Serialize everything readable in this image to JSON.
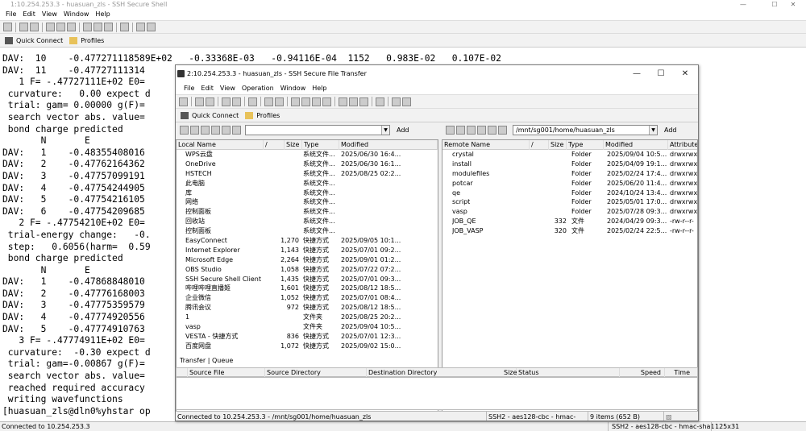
{
  "terminal": {
    "title": "1:10.254.253.3 - huasuan_zls - SSH Secure Shell",
    "menu": [
      "File",
      "Edit",
      "View",
      "Window",
      "Help"
    ],
    "quick_connect": "Quick Connect",
    "profiles": "Profiles",
    "lines": [
      "DAV:  10    -0.477271118589E+02   -0.33368E-03   -0.94116E-04  1152   0.983E-02   0.107E-02",
      "DAV:  11    -0.47727111314",
      "   1 F= -.47727111E+02 E0=",
      " curvature:   0.00 expect d",
      " trial: gam= 0.00000 g(F)=",
      " search vector abs. value=",
      " bond charge predicted",
      "       N       E",
      "DAV:   1    -0.48355408016",
      "DAV:   2    -0.47762164362",
      "DAV:   3    -0.47757099191",
      "DAV:   4    -0.47754244905",
      "DAV:   5    -0.47754216105",
      "DAV:   6    -0.47754209685",
      "   2 F= -.47754210E+02 E0=",
      " trial-energy change:   -0.",
      " step:   0.6056(harm=  0.59",
      " bond charge predicted",
      "       N       E",
      "DAV:   1    -0.47868848010",
      "DAV:   2    -0.47776168003",
      "DAV:   3    -0.47775359579",
      "DAV:   4    -0.47774920556",
      "DAV:   5    -0.47774910763",
      "   3 F= -.47774911E+02 E0=",
      " curvature:  -0.30 expect d",
      " trial: gam=-0.00867 g(F)=",
      " search vector abs. value=",
      " reached required accuracy",
      " writing wavefunctions",
      "[huasuan_zls@dln0%yhstar op"
    ],
    "status_left": "Connected to 10.254.253.3",
    "status_cipher": "SSH2 - aes128-cbc - hmac-sha1",
    "status_size": "125x31"
  },
  "sftp": {
    "title": "2:10.254.253.3 - huasuan_zls - SSH Secure File Transfer",
    "menu": [
      "File",
      "Edit",
      "View",
      "Operation",
      "Window",
      "Help"
    ],
    "quick_connect": "Quick Connect",
    "profiles": "Profiles",
    "add_label": "Add",
    "local_path": "",
    "remote_path": "/mnt/sg001/home/huasuan_zls",
    "local_headers": [
      "Local Name",
      "/",
      "Size",
      "Type",
      "Modified"
    ],
    "remote_headers": [
      "Remote Name",
      "/",
      "Size",
      "Type",
      "Modified",
      "Attribute"
    ],
    "local_files": [
      {
        "name": "WPS云盘",
        "size": "",
        "type": "系统文件...",
        "mod": "2025/06/30 16:4...",
        "ic": "cloud"
      },
      {
        "name": "OneDrive",
        "size": "",
        "type": "系统文件...",
        "mod": "2025/06/30 16:1...",
        "ic": "cloud"
      },
      {
        "name": "HSTECH",
        "size": "",
        "type": "系统文件...",
        "mod": "2025/08/25 02:2...",
        "ic": "user"
      },
      {
        "name": "此电脑",
        "size": "",
        "type": "系统文件...",
        "mod": "",
        "ic": "pc"
      },
      {
        "name": "库",
        "size": "",
        "type": "系统文件...",
        "mod": "",
        "ic": "folder"
      },
      {
        "name": "网络",
        "size": "",
        "type": "系统文件...",
        "mod": "",
        "ic": "pc"
      },
      {
        "name": "控制面板",
        "size": "",
        "type": "系统文件...",
        "mod": "",
        "ic": "pc"
      },
      {
        "name": "回收站",
        "size": "",
        "type": "系统文件...",
        "mod": "",
        "ic": "pc"
      },
      {
        "name": "控制面板",
        "size": "",
        "type": "系统文件...",
        "mod": "",
        "ic": "pc"
      },
      {
        "name": "EasyConnect",
        "size": "1,270",
        "type": "快捷方式",
        "mod": "2025/09/05 10:1...",
        "ic": "app"
      },
      {
        "name": "Internet Explorer",
        "size": "1,143",
        "type": "快捷方式",
        "mod": "2025/07/01 09:2...",
        "ic": "app"
      },
      {
        "name": "Microsoft Edge",
        "size": "2,264",
        "type": "快捷方式",
        "mod": "2025/09/01 01:2...",
        "ic": "app"
      },
      {
        "name": "OBS Studio",
        "size": "1,058",
        "type": "快捷方式",
        "mod": "2025/07/22 07:2...",
        "ic": "app"
      },
      {
        "name": "SSH Secure Shell Client",
        "size": "1,435",
        "type": "快捷方式",
        "mod": "2025/07/01 09:3...",
        "ic": "app"
      },
      {
        "name": "哔哩哔哩直播姬",
        "size": "1,601",
        "type": "快捷方式",
        "mod": "2025/08/12 18:5...",
        "ic": "app"
      },
      {
        "name": "企业微信",
        "size": "1,052",
        "type": "快捷方式",
        "mod": "2025/07/01 08:4...",
        "ic": "app"
      },
      {
        "name": "腾讯会议",
        "size": "972",
        "type": "快捷方式",
        "mod": "2025/08/12 18:5...",
        "ic": "app"
      },
      {
        "name": "1",
        "size": "",
        "type": "文件夹",
        "mod": "2025/08/25 20:2...",
        "ic": "folder"
      },
      {
        "name": "vasp",
        "size": "",
        "type": "文件夹",
        "mod": "2025/09/04 10:5...",
        "ic": "folder"
      },
      {
        "name": "VESTA - 快捷方式",
        "size": "836",
        "type": "快捷方式",
        "mod": "2025/07/01 12:3...",
        "ic": "app"
      },
      {
        "name": "百度网盘",
        "size": "1,072",
        "type": "快捷方式",
        "mod": "2025/09/02 15:0...",
        "ic": "cloud"
      }
    ],
    "remote_files": [
      {
        "name": "crystal",
        "size": "",
        "type": "Folder",
        "mod": "2025/09/04 10:5...",
        "attr": "drwxrwx",
        "ic": "folder"
      },
      {
        "name": "install",
        "size": "",
        "type": "Folder",
        "mod": "2025/04/09 19:1...",
        "attr": "drwxrwx",
        "ic": "folder"
      },
      {
        "name": "modulefiles",
        "size": "",
        "type": "Folder",
        "mod": "2025/02/24 17:4...",
        "attr": "drwxrwx",
        "ic": "folder"
      },
      {
        "name": "potcar",
        "size": "",
        "type": "Folder",
        "mod": "2025/06/20 11:4...",
        "attr": "drwxrwx",
        "ic": "folder"
      },
      {
        "name": "qe",
        "size": "",
        "type": "Folder",
        "mod": "2024/10/24 13:4...",
        "attr": "drwxrwx",
        "ic": "folder"
      },
      {
        "name": "script",
        "size": "",
        "type": "Folder",
        "mod": "2025/05/01 17:0...",
        "attr": "drwxrwx",
        "ic": "folder"
      },
      {
        "name": "vasp",
        "size": "",
        "type": "Folder",
        "mod": "2025/07/28 09:3...",
        "attr": "drwxrwx",
        "ic": "folder"
      },
      {
        "name": "JOB_QE",
        "size": "332",
        "type": "文件",
        "mod": "2024/04/29 09:3...",
        "attr": "-rw-r--r-",
        "ic": "file"
      },
      {
        "name": "JOB_VASP",
        "size": "320",
        "type": "文件",
        "mod": "2025/02/24 22:5...",
        "attr": "-rw-r--r-",
        "ic": "file"
      }
    ],
    "tq_tabs": [
      "Transfer",
      "Queue"
    ],
    "tq_headers": [
      "Source File",
      "Source Directory",
      "Destination Directory",
      "Size",
      "Status",
      "Speed",
      "Time"
    ],
    "status_left": "Connected to 10.254.253.3 - /mnt/sg001/home/huasuan_zls",
    "status_cipher": "SSH2 - aes128-cbc - hmac-sha1",
    "status_items": "9 items (652 B)"
  },
  "colors": {
    "folder": "#e8c25a",
    "cloud": "#2f7fd8",
    "app": "#3b8c3b",
    "pc": "#4a90c8",
    "user": "#3a6fb0",
    "file": "#ffffff"
  }
}
